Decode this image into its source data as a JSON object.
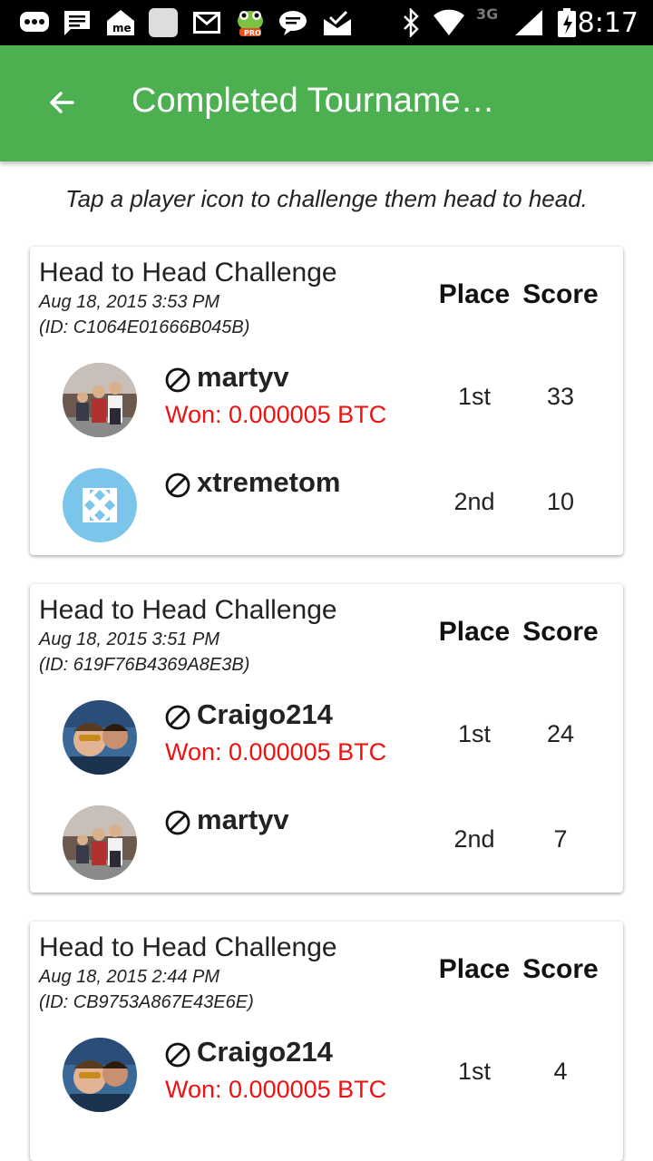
{
  "status_bar": {
    "time": "8:17",
    "network": "3G",
    "icons": [
      "messenger-icon",
      "message-icon",
      "meme-icon",
      "blank-app-icon",
      "gmail-icon",
      "frog-pro-icon",
      "chat-bubble-icon",
      "mail-check-icon",
      "bluetooth-icon",
      "wifi-icon",
      "signal-icon",
      "battery-charging-icon"
    ]
  },
  "app_bar": {
    "title": "Completed Tourname…",
    "back_icon": "arrow-left-icon",
    "color": "#4caf50"
  },
  "hint": "Tap a player icon to challenge them head to head.",
  "cards": [
    {
      "title": "Head to Head Challenge",
      "date": "Aug 18, 2015 3:53 PM",
      "id": "(ID: C1064E01666B045B)",
      "place_header": "Place",
      "score_header": "Score",
      "players": [
        {
          "name": "martyv",
          "won": "Won: 0.000005 BTC",
          "place": "1st",
          "score": "33",
          "avatar": "family-photo"
        },
        {
          "name": "xtremetom",
          "won": "",
          "place": "2nd",
          "score": "10",
          "avatar": "blue-pattern"
        }
      ]
    },
    {
      "title": "Head to Head Challenge",
      "date": "Aug 18, 2015 3:51 PM",
      "id": "(ID: 619F76B4369A8E3B)",
      "place_header": "Place",
      "score_header": "Score",
      "players": [
        {
          "name": "Craigo214",
          "won": "Won: 0.000005 BTC",
          "place": "1st",
          "score": "24",
          "avatar": "selfie-photo"
        },
        {
          "name": "martyv",
          "won": "",
          "place": "2nd",
          "score": "7",
          "avatar": "family-photo"
        }
      ]
    },
    {
      "title": "Head to Head Challenge",
      "date": "Aug 18, 2015 2:44 PM",
      "id": "(ID: CB9753A867E43E6E)",
      "place_header": "Place",
      "score_header": "Score",
      "players": [
        {
          "name": "Craigo214",
          "won": "Won: 0.000005 BTC",
          "place": "1st",
          "score": "4",
          "avatar": "selfie-photo"
        }
      ]
    }
  ]
}
